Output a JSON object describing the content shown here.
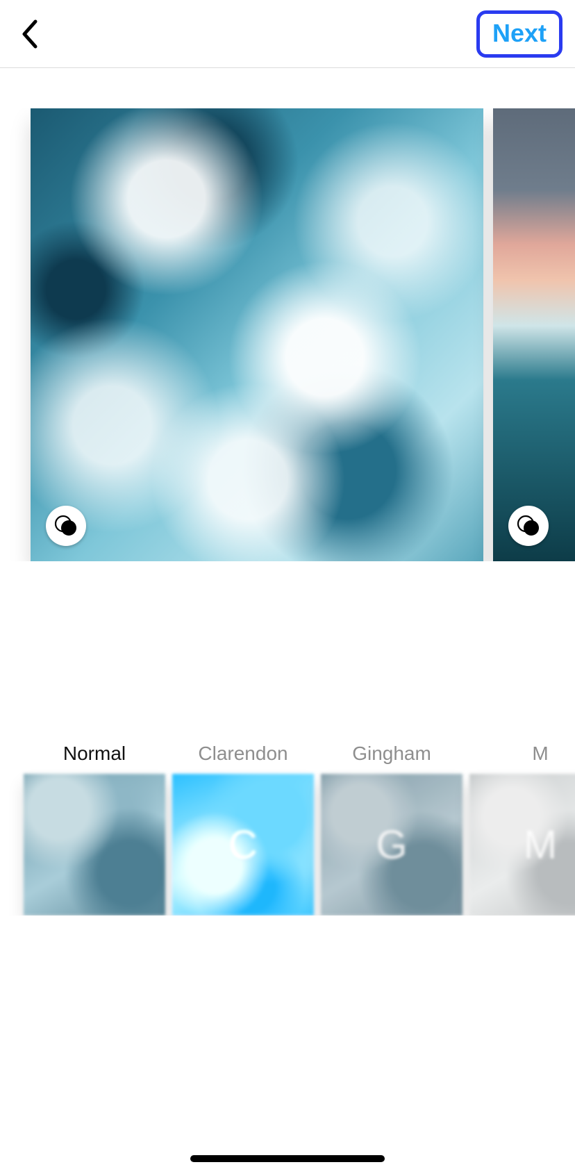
{
  "header": {
    "next_label": "Next"
  },
  "photos": [
    {
      "lux_icon": "venn-icon"
    },
    {
      "lux_icon": "venn-icon"
    }
  ],
  "filters": {
    "selected_index": 0,
    "items": [
      {
        "label": "Normal",
        "letter": ""
      },
      {
        "label": "Clarendon",
        "letter": "C"
      },
      {
        "label": "Gingham",
        "letter": "G"
      },
      {
        "label": "M",
        "letter": "M"
      }
    ]
  }
}
